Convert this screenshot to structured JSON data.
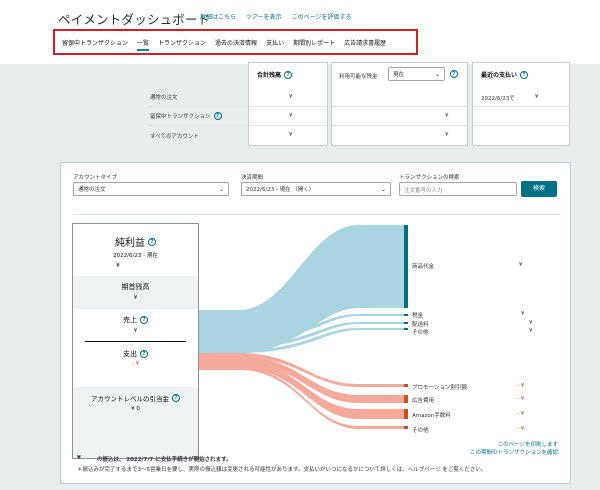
{
  "header": {
    "title": "ペイメントダッシュボード",
    "links": [
      "詳細はこちら",
      "ツアーを表示",
      "このページを評価する"
    ]
  },
  "tabs": [
    "留保中トランザクション",
    "一覧",
    "トランザクション",
    "過去の決済情報",
    "支払い",
    "期間別レポート",
    "広告請求書履歴"
  ],
  "summary": {
    "row_labels": [
      "通常の注文",
      "留保中トランザクション",
      "すべてのアカウント"
    ],
    "total_header": "合計残高",
    "available_label": "利用可能な残金",
    "available_option": "現在",
    "latest_header": "最近の支払い",
    "latest_date": "2022/6/23で",
    "yen": "¥"
  },
  "filters": {
    "account_type_label": "アカウントタイプ",
    "account_type_value": "通常の注文",
    "period_label": "決済期間",
    "period_value": "2022/6/23 - 現在 （開く）",
    "search_label": "トランザクションの検索",
    "search_placeholder": "注文番号の入力",
    "search_button": "検索"
  },
  "stack": {
    "net_label": "純利益",
    "net_date": "2022/6/23 - 現在",
    "yen": "¥",
    "opening_label": "期首残高",
    "sales_label": "売上",
    "expense_label": "支出",
    "neg_yen": "- ¥",
    "reserve_label": "アカウントレベルの引当金",
    "reserve_value": "¥ 0"
  },
  "flow": {
    "income": [
      {
        "label": "商品代金",
        "value": "¥"
      },
      {
        "label": "税金",
        "value": "¥"
      },
      {
        "label": "配送料",
        "value": "¥"
      },
      {
        "label": "その他",
        "value": "¥"
      }
    ],
    "expenses": [
      {
        "label": "プロモーション割引額",
        "value": "- ¥"
      },
      {
        "label": "広告費用",
        "value": "- ¥"
      },
      {
        "label": "Amazon手数料",
        "value": "- ¥"
      },
      {
        "label": "その他",
        "value": "- ¥"
      }
    ],
    "colors": {
      "income": "#a8d5df",
      "income_bar": "#007185",
      "expense": "#f4a99a",
      "expense_bar": "#c7511f"
    }
  },
  "footer": {
    "print_link": "このページを印刷します",
    "period_link": "この期間のトランザクションを確認",
    "notice_yen": "¥",
    "notice_text": "の振込は、 2022/7/7 に支払手続きが開始されます。",
    "note": "＊振込みが完了するまで3～5営業日を要し、実際の振込額は変更される可能性があります。支払いがいつになるかについて詳しくは、ヘルプページ をご覧ください。"
  }
}
